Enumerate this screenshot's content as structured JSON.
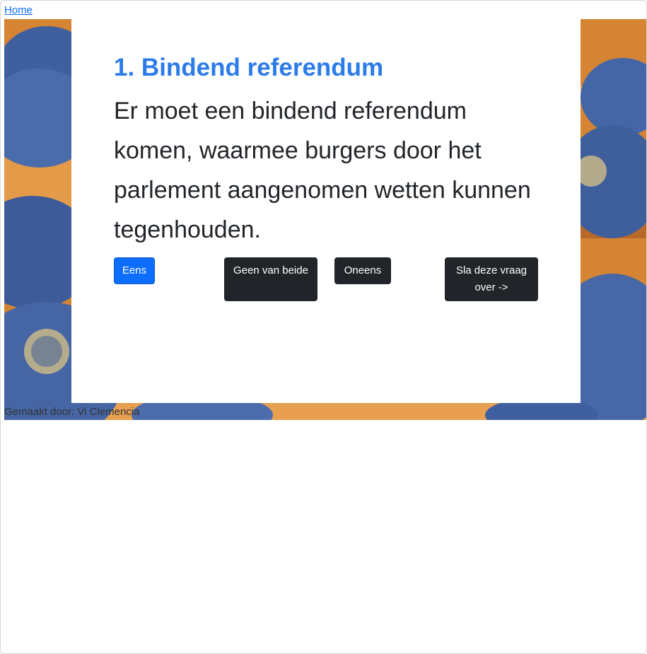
{
  "nav": {
    "home_label": "Home"
  },
  "question": {
    "title": "1. Bindend referendum",
    "text": "Er moet een bindend referendum komen, waarmee burgers door het parlement aangenomen wetten kunnen tegenhouden."
  },
  "answers": {
    "agree_label": "Eens",
    "neutral_label": "Geen van beide",
    "disagree_label": "Oneens",
    "skip_label": "Sla deze vraag over ->"
  },
  "footer": {
    "credit": "Gemaakt door: Vi Clemencia"
  },
  "colors": {
    "title": "#2b7be9",
    "primary": "#0d6efd",
    "dark": "#212529",
    "seat_blue": "#4a6aa8",
    "desk_orange": "#d9893a"
  }
}
